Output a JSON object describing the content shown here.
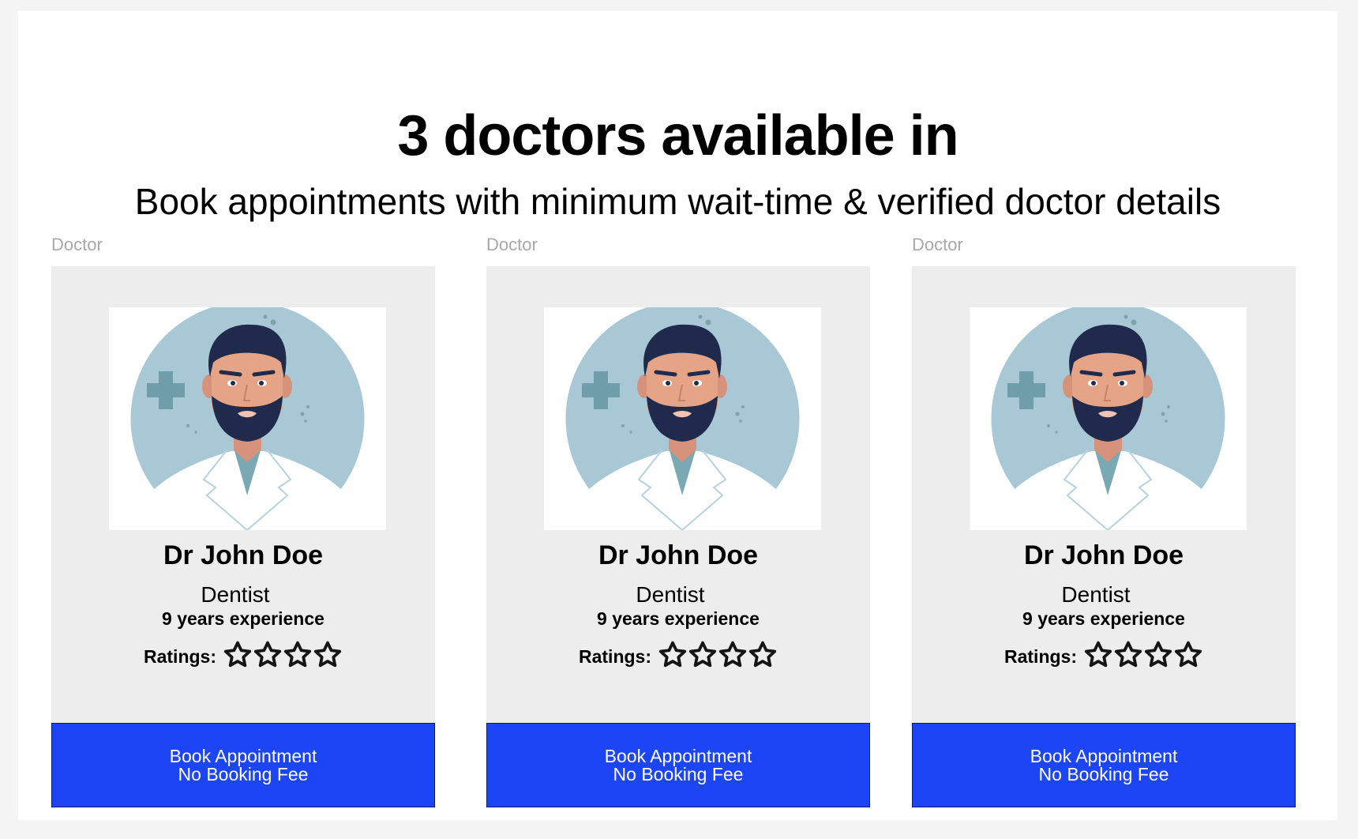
{
  "header": {
    "title": "3 doctors available in",
    "subtitle": "Book appointments with minimum wait-time & verified doctor details"
  },
  "doctors": [
    {
      "section_label": "Doctor",
      "name": "Dr John Doe",
      "specialty": "Dentist",
      "experience": "9 years experience",
      "ratings_label": "Ratings:",
      "rating_stars": 4,
      "button_line1": "Book Appointment",
      "button_line2": "No Booking Fee",
      "photo_icon": "doctor-avatar-illustration"
    },
    {
      "section_label": "Doctor",
      "name": "Dr John Doe",
      "specialty": "Dentist",
      "experience": "9 years experience",
      "ratings_label": "Ratings:",
      "rating_stars": 4,
      "button_line1": "Book Appointment",
      "button_line2": "No Booking Fee",
      "photo_icon": "doctor-avatar-illustration"
    },
    {
      "section_label": "Doctor",
      "name": "Dr John Doe",
      "specialty": "Dentist",
      "experience": "9 years experience",
      "ratings_label": "Ratings:",
      "rating_stars": 4,
      "button_line1": "Book Appointment",
      "button_line2": "No Booking Fee",
      "photo_icon": "doctor-avatar-illustration"
    }
  ],
  "colors": {
    "page_background": "#f4f4f4",
    "card_background": "#ededed",
    "button_background": "#1c45f5",
    "button_text": "#ffffff",
    "section_label": "#a8a8a8",
    "avatar_circle": "#a8c8d6"
  }
}
